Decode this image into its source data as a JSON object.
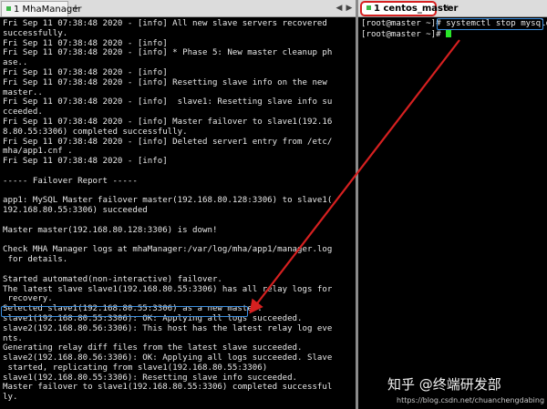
{
  "left_pane": {
    "tab_label": "1 MhaManager",
    "add_tab": "+",
    "nav_prev": "◀",
    "nav_next": "▶",
    "lines": [
      "Fri Sep 11 07:38:48 2020 - [info] All new slave servers recovered",
      "successfully.",
      "Fri Sep 11 07:38:48 2020 - [info]",
      "Fri Sep 11 07:38:48 2020 - [info] * Phase 5: New master cleanup ph",
      "ase..",
      "Fri Sep 11 07:38:48 2020 - [info]",
      "Fri Sep 11 07:38:48 2020 - [info] Resetting slave info on the new",
      "master..",
      "Fri Sep 11 07:38:48 2020 - [info]  slave1: Resetting slave info su",
      "cceeded.",
      "Fri Sep 11 07:38:48 2020 - [info] Master failover to slave1(192.16",
      "8.80.55:3306) completed successfully.",
      "Fri Sep 11 07:38:48 2020 - [info] Deleted server1 entry from /etc/",
      "mha/app1.cnf .",
      "Fri Sep 11 07:38:48 2020 - [info]",
      "",
      "----- Failover Report -----",
      "",
      "app1: MySQL Master failover master(192.168.80.128:3306) to slave1(",
      "192.168.80.55:3306) succeeded",
      "",
      "Master master(192.168.80.128:3306) is down!",
      "",
      "Check MHA Manager logs at mhaManager:/var/log/mha/app1/manager.log",
      " for details.",
      "",
      "Started automated(non-interactive) failover.",
      "The latest slave slave1(192.168.80.55:3306) has all relay logs for",
      " recovery.",
      "Selected slave1(192.168.80.55:3306) as a new master.",
      "slave1(192.168.80.55:3306): OK: Applying all logs succeeded.",
      "slave2(192.168.80.56:3306): This host has the latest relay log eve",
      "nts.",
      "Generating relay diff files from the latest slave succeeded.",
      "slave2(192.168.80.56:3306): OK: Applying all logs succeeded. Slave",
      " started, replicating from slave1(192.168.80.55:3306)",
      "slave1(192.168.80.55:3306): Resetting slave info succeeded.",
      "Master failover to slave1(192.168.80.55:3306) completed successful",
      "ly."
    ]
  },
  "right_pane": {
    "tab_label": "1 centos_master",
    "add_tab": "+",
    "line1_prompt": "[root@master ~]# ",
    "line1_command": "systemctl stop mysqld",
    "line2_prompt": "[root@master ~]# "
  },
  "watermark": {
    "title": "知乎 @终端研发部",
    "url": "https://blog.csdn.net/chuanchengdabing"
  },
  "colors": {
    "terminal_bg": "#000000",
    "terminal_fg": "#e8e8e8",
    "highlight_box": "#3b8fe0",
    "annotation_red": "#d62020",
    "cursor": "#29e629"
  }
}
